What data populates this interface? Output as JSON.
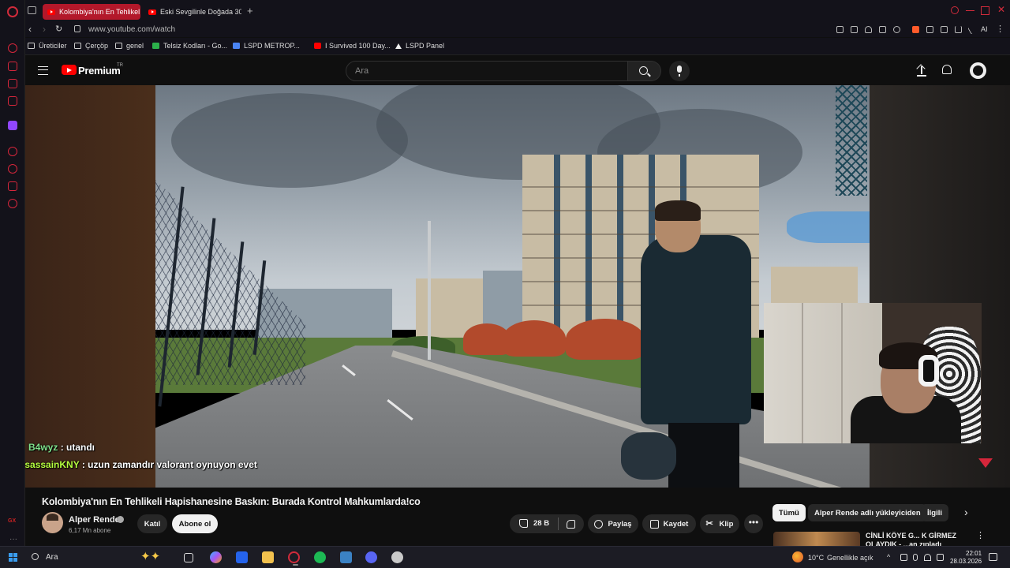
{
  "browser": {
    "tabs": [
      {
        "title": "Kolombiya'nın En Tehlikel",
        "active": true
      },
      {
        "title": "Eski Sevgilinle Doğada 30",
        "active": false
      }
    ],
    "new_tab_glyph": "+",
    "url": "www.youtube.com/watch",
    "ai_label": "AI",
    "bookmarks": [
      {
        "label": "Üreticiler",
        "icon": "folder-icon"
      },
      {
        "label": "Çerçöp",
        "icon": "folder-icon"
      },
      {
        "label": "genel",
        "icon": "folder-icon"
      },
      {
        "label": "Telsiz Kodları - Go...",
        "icon": "sheets-icon"
      },
      {
        "label": "LSPD METROP...",
        "icon": "docs-icon"
      },
      {
        "label": "I Survived 100 Day...",
        "icon": "youtube-icon"
      },
      {
        "label": "LSPD Panel",
        "icon": "drive-icon"
      }
    ]
  },
  "youtube": {
    "brand": "Premium",
    "region": "TR",
    "search_placeholder": "Ara"
  },
  "chat_overlay": [
    {
      "user": "B4wyz",
      "message": " : utandı",
      "badge": false
    },
    {
      "user": "assassainKNY",
      "message": " : uzun zamandır valorant oynuyon evet",
      "badge": true
    }
  ],
  "video": {
    "title": "Kolombiya'nın En Tehlikeli Hapishanesine Baskın: Burada Kontrol Mahkumlarda!co",
    "channel": "Alper Rende",
    "subscribers": "6,17 Mn abone",
    "join_label": "Katıl",
    "subscribe_label": "Abone ol",
    "likes": "28 B",
    "share_label": "Paylaş",
    "save_label": "Kaydet",
    "clip_label": "Klip",
    "more_glyph": "•••"
  },
  "recommendations": {
    "chips": [
      "Tümü",
      "Alper Rende adlı yükleyiciden",
      "İlgili"
    ],
    "selected_chip": "Tümü",
    "first_title": "CİNLİ KÖYE G... K GİRMEZ OLAYDIK - ...an zıpladı"
  },
  "taskbar": {
    "search_label": "Ara",
    "weather": "10°C",
    "weather_desc": "Genellikle açık",
    "time": "22:01",
    "date": "28.03.2026"
  },
  "colors": {
    "opera_red": "#d12b3b",
    "youtube_red": "#ff0000",
    "background": "#0f0f0f"
  }
}
